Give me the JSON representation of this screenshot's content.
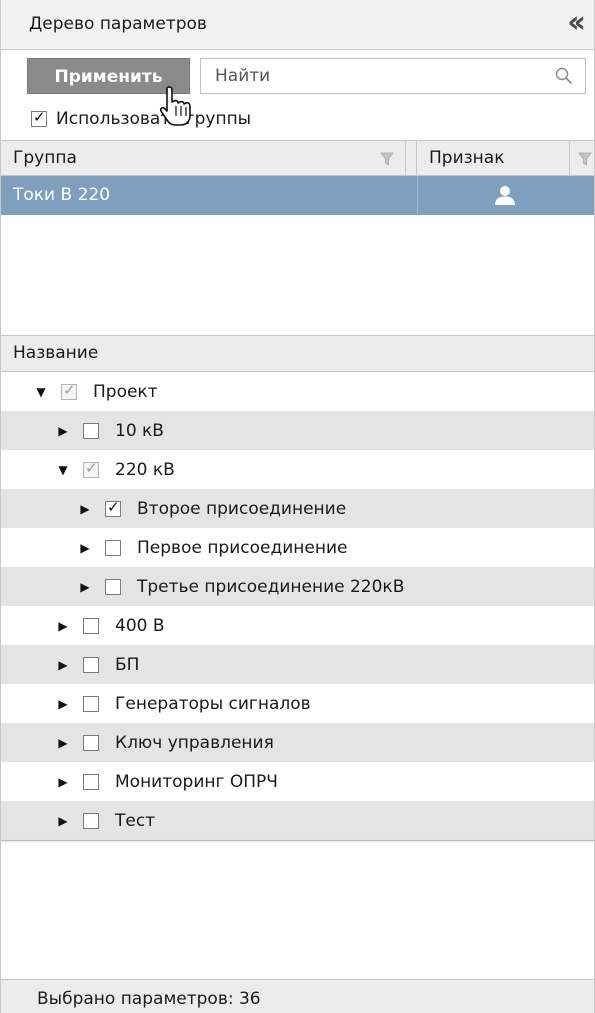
{
  "header": {
    "title": "Дерево параметров",
    "collapse_icon": "double-chevron-left-icon"
  },
  "toolbar": {
    "apply_label": "Применить",
    "search_placeholder": "Найти",
    "search_icon": "search-icon"
  },
  "use_groups": {
    "label": "Использовать группы",
    "checked": true
  },
  "group_table": {
    "columns": [
      "Группа",
      "Признак"
    ],
    "rows": [
      {
        "name": "Токи В 220",
        "flag_icon": "person-icon",
        "selected": true
      }
    ]
  },
  "tree": {
    "header": "Название",
    "items": [
      {
        "label": "Проект",
        "level": 0,
        "expanded": true,
        "checked": true,
        "partial": true
      },
      {
        "label": "10 кВ",
        "level": 1,
        "expanded": false,
        "checked": false
      },
      {
        "label": "220 кВ",
        "level": 1,
        "expanded": true,
        "checked": true,
        "partial": true
      },
      {
        "label": "Второе присоединение",
        "level": 2,
        "expanded": false,
        "checked": true
      },
      {
        "label": "Первое присоединение",
        "level": 2,
        "expanded": false,
        "checked": false
      },
      {
        "label": "Третье присоединение 220кВ",
        "level": 2,
        "expanded": false,
        "checked": false
      },
      {
        "label": "400 В",
        "level": 1,
        "expanded": false,
        "checked": false
      },
      {
        "label": "БП",
        "level": 1,
        "expanded": false,
        "checked": false
      },
      {
        "label": "Генераторы сигналов",
        "level": 1,
        "expanded": false,
        "checked": false
      },
      {
        "label": "Ключ управления",
        "level": 1,
        "expanded": false,
        "checked": false
      },
      {
        "label": "Мониторинг ОПРЧ",
        "level": 1,
        "expanded": false,
        "checked": false
      },
      {
        "label": "Тест",
        "level": 1,
        "expanded": false,
        "checked": false
      }
    ]
  },
  "status": {
    "text": "Выбрано параметров: 36"
  },
  "colors": {
    "selected_row": "#7e9fbd",
    "apply_button": "#8a8a8a",
    "header_bg": "#ececec"
  }
}
